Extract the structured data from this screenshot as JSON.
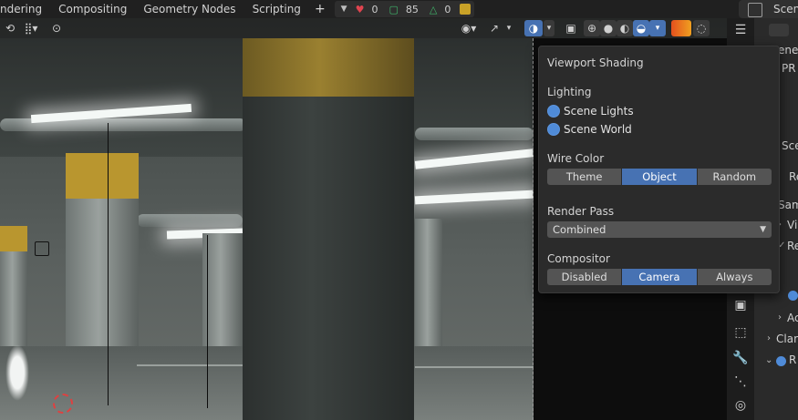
{
  "topbar": {
    "tabs": [
      "ndering",
      "Compositing",
      "Geometry Nodes",
      "Scripting"
    ],
    "add_label": "+",
    "stats": {
      "heart": "0",
      "square": "85",
      "triangle": "0"
    },
    "scene_label": "Scen"
  },
  "viewport_shading_popup": {
    "title": "Viewport Shading",
    "lighting_label": "Lighting",
    "lighting_options": [
      "Scene Lights",
      "Scene World"
    ],
    "wire_color_label": "Wire Color",
    "wire_color_options": [
      "Theme",
      "Object",
      "Random"
    ],
    "wire_color_selected": "Object",
    "render_pass_label": "Render Pass",
    "render_pass_value": "Combined",
    "compositor_label": "Compositor",
    "compositor_options": [
      "Disabled",
      "Camera",
      "Always"
    ],
    "compositor_selected": "Camera"
  },
  "properties_panel": {
    "lines": [
      "ene",
      "PR",
      "Sce",
      "Re",
      "Sam",
      "Vi",
      "Re",
      "Ac",
      "Clar",
      "R"
    ]
  },
  "colors": {
    "accent": "#4772b3",
    "popup_bg": "#2b2b2b",
    "stat_red": "#e0444f",
    "stat_green": "#3fb56a"
  }
}
